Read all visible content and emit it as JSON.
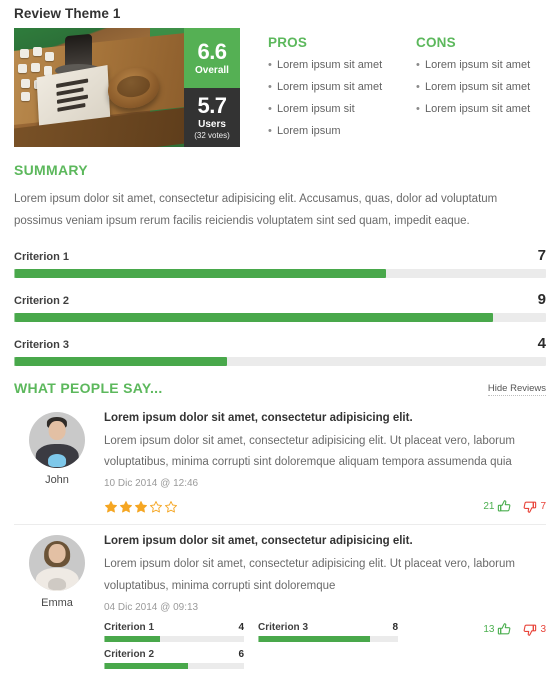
{
  "page_title": "Review Theme 1",
  "score": {
    "overall_value": "6.6",
    "overall_label": "Overall",
    "users_value": "5.7",
    "users_label": "Users",
    "votes_label": "(32 votes)",
    "overall_color": "#55b054",
    "users_color": "#333333"
  },
  "pros": {
    "title": "PROS",
    "items": [
      "Lorem ipsum sit amet",
      "Lorem ipsum sit amet",
      "Lorem ipsum sit",
      "Lorem ipsum"
    ]
  },
  "cons": {
    "title": "CONS",
    "items": [
      "Lorem ipsum sit amet",
      "Lorem ipsum sit amet",
      "Lorem ipsum sit amet"
    ]
  },
  "summary": {
    "title": "SUMMARY",
    "text": "Lorem ipsum dolor sit amet, consectetur adipisicing elit. Accusamus, quas, dolor ad voluptatum possimus veniam ipsum rerum facilis reiciendis voluptatem sint sed quam, impedit eaque."
  },
  "criteria": [
    {
      "name": "Criterion 1",
      "value": "7",
      "percent": 70
    },
    {
      "name": "Criterion 2",
      "value": "9",
      "percent": 90
    },
    {
      "name": "Criterion 3",
      "value": "4",
      "percent": 40
    }
  ],
  "reviews_section": {
    "title": "WHAT PEOPLE SAY...",
    "toggle_label": "Hide Reviews"
  },
  "reviews": [
    {
      "author": "John",
      "title": "Lorem ipsum dolor sit amet, consectetur adipisicing elit.",
      "text": "Lorem ipsum dolor sit amet, consectetur adipisicing elit. Ut placeat vero, laborum voluptatibus, minima corrupti sint doloremque aliquam tempora assumenda quia",
      "date": "10 Dic 2014 @ 12:46",
      "stars_filled": 3,
      "stars_total": 5,
      "votes_up": "21",
      "votes_down": "7"
    },
    {
      "author": "Emma",
      "title": "Lorem ipsum dolor sit amet, consectetur adipisicing elit.",
      "text": "Lorem ipsum dolor sit amet, consectetur adipisicing elit. Ut placeat vero, laborum voluptatibus, minima corrupti sint doloremque",
      "date": "04 Dic 2014 @ 09:13",
      "votes_up": "13",
      "votes_down": "3",
      "criteria": [
        {
          "name": "Criterion 1",
          "value": "4",
          "percent": 40
        },
        {
          "name": "Criterion 2",
          "value": "6",
          "percent": 60
        },
        {
          "name": "Criterion 3",
          "value": "8",
          "percent": 80
        }
      ]
    }
  ],
  "colors": {
    "accent_green": "#5cb85c",
    "bar_green": "#49a84b",
    "star_orange": "#f5a623",
    "vote_up": "#4caf50",
    "vote_down": "#e8443a"
  }
}
